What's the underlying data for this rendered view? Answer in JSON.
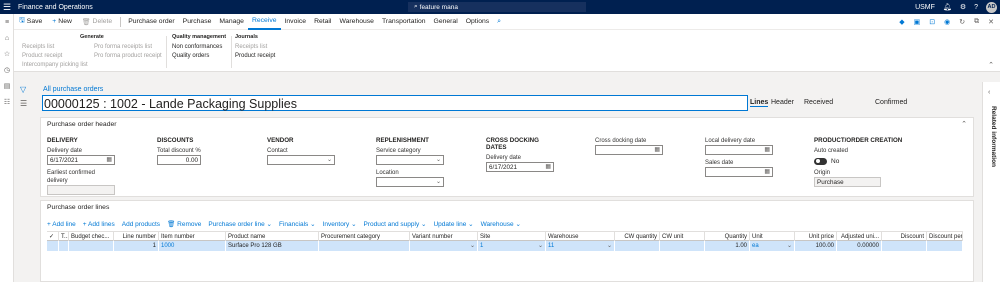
{
  "topbar": {
    "waffle_icon": "waffle-icon",
    "app_name": "Finance and Operations",
    "search_value": "feature mana",
    "company": "USMF",
    "avatar_initials": "AD"
  },
  "action_pane": {
    "save": "Save",
    "new": "New",
    "delete": "Delete",
    "tabs": [
      "Purchase order",
      "Purchase",
      "Manage",
      "Receive",
      "Invoice",
      "Retail",
      "Warehouse",
      "Transportation",
      "General",
      "Options"
    ],
    "active_tab": "Receive"
  },
  "ribbon": {
    "group1": {
      "items": [
        "Receipts list",
        "Product receipt",
        "Intercompany picking list"
      ]
    },
    "group2": {
      "title": "Generate",
      "items": [
        "Pro forma receipts list",
        "Pro forma product receipt"
      ]
    },
    "group3": {
      "title": "Quality management",
      "items": [
        "Non conformances",
        "Quality orders"
      ]
    },
    "group4": {
      "title": "Journals",
      "items": [
        "Receipts list",
        "Product receipt"
      ]
    }
  },
  "header": {
    "breadcrumb": "All purchase orders",
    "title": "00000125 : 1002 - Lande Packaging Supplies",
    "tab_lines": "Lines",
    "tab_header": "Header",
    "status1": "Received",
    "status2": "Confirmed"
  },
  "related_info": "Related information",
  "po_header": {
    "title": "Purchase order header",
    "delivery": {
      "title": "DELIVERY",
      "delivery_date_label": "Delivery date",
      "delivery_date": "6/17/2021",
      "earliest_label": "Earliest confirmed delivery",
      "earliest": ""
    },
    "discounts": {
      "title": "DISCOUNTS",
      "total_label": "Total discount %",
      "total": "0.00"
    },
    "vendor": {
      "title": "VENDOR",
      "contact_label": "Contact",
      "contact": ""
    },
    "replenishment": {
      "title": "REPLENISHMENT",
      "service_label": "Service category",
      "service": "",
      "location_label": "Location",
      "location": ""
    },
    "cross_docking": {
      "title": "CROSS DOCKING DATES",
      "delivery_date_label": "Delivery date",
      "delivery_date": "6/17/2021",
      "cross_label": "Cross docking date",
      "cross": ""
    },
    "local": {
      "local_label": "Local delivery date",
      "local": "",
      "sales_label": "Sales date",
      "sales": ""
    },
    "product": {
      "title": "PRODUCT/ORDER CREATION",
      "auto_label": "Auto created",
      "auto_value": "No",
      "origin_label": "Origin",
      "origin": "Purchase"
    }
  },
  "po_lines": {
    "title": "Purchase order lines",
    "toolbar": [
      "Add line",
      "Add lines",
      "Add products",
      "Remove",
      "Purchase order line",
      "Financials",
      "Inventory",
      "Product and supply",
      "Update line",
      "Warehouse"
    ],
    "columns": [
      "T...",
      "Budget chec...",
      "Line number",
      "Item number",
      "Product name",
      "Procurement category",
      "Variant number",
      "Site",
      "Warehouse",
      "CW quantity",
      "CW unit",
      "Quantity",
      "Unit",
      "Unit price",
      "Adjusted uni...",
      "Discount",
      "Discount per"
    ],
    "row": {
      "line_number": "1",
      "item_number": "1000",
      "product_name": "Surface Pro 128 GB",
      "site": "1",
      "warehouse": "11",
      "quantity": "1.00",
      "unit": "ea",
      "unit_price": "100.00",
      "adjusted": "0.00000"
    }
  }
}
